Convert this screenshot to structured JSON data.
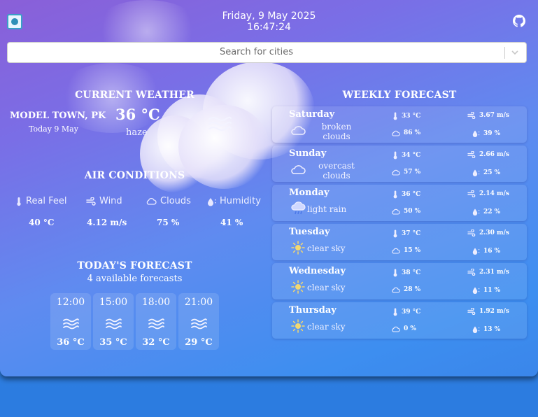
{
  "header": {
    "date": "Friday, 9 May 2025",
    "time": "16:47:24"
  },
  "search": {
    "placeholder": "Search for cities"
  },
  "current": {
    "title": "CURRENT WEATHER",
    "city": "MODEL TOWN, PK",
    "date": "Today 9 May",
    "temp": "36 °C",
    "description": "haze",
    "icon": "haze-icon"
  },
  "air": {
    "title": "AIR CONDITIONS",
    "items": [
      {
        "label": "Real Feel",
        "value": "40 °C",
        "icon": "thermometer-icon"
      },
      {
        "label": "Wind",
        "value": "4.12 m/s",
        "icon": "wind-icon"
      },
      {
        "label": "Clouds",
        "value": "75 %",
        "icon": "cloud-icon"
      },
      {
        "label": "Humidity",
        "value": "41 %",
        "icon": "humidity-icon"
      }
    ]
  },
  "today_forecast": {
    "title": "TODAY'S FORECAST",
    "subtitle": "4 available forecasts",
    "items": [
      {
        "time": "12:00",
        "temp": "36 °C",
        "icon": "haze-icon"
      },
      {
        "time": "15:00",
        "temp": "35 °C",
        "icon": "haze-icon"
      },
      {
        "time": "18:00",
        "temp": "32 °C",
        "icon": "haze-icon"
      },
      {
        "time": "21:00",
        "temp": "29 °C",
        "icon": "haze-icon"
      }
    ]
  },
  "weekly": {
    "title": "WEEKLY FORECAST",
    "days": [
      {
        "day": "Saturday",
        "cond1": "broken",
        "cond2": "clouds",
        "icon": "cloud-icon",
        "temp": "33 °C",
        "wind": "3.67 m/s",
        "clouds": "86 %",
        "humidity": "39 %"
      },
      {
        "day": "Sunday",
        "cond1": "overcast",
        "cond2": "clouds",
        "icon": "cloud-icon",
        "temp": "34 °C",
        "wind": "2.66 m/s",
        "clouds": "57 %",
        "humidity": "25 %"
      },
      {
        "day": "Monday",
        "cond1": "light rain",
        "cond2": "",
        "icon": "rain-icon",
        "temp": "36 °C",
        "wind": "2.14 m/s",
        "clouds": "50 %",
        "humidity": "22 %"
      },
      {
        "day": "Tuesday",
        "cond1": "clear sky",
        "cond2": "",
        "icon": "sun-icon",
        "temp": "37 °C",
        "wind": "2.30 m/s",
        "clouds": "15 %",
        "humidity": "16 %"
      },
      {
        "day": "Wednesday",
        "cond1": "clear sky",
        "cond2": "",
        "icon": "sun-icon",
        "temp": "38 °C",
        "wind": "2.31 m/s",
        "clouds": "28 %",
        "humidity": "11 %"
      },
      {
        "day": "Thursday",
        "cond1": "clear sky",
        "cond2": "",
        "icon": "sun-icon",
        "temp": "39 °C",
        "wind": "1.92 m/s",
        "clouds": "0 %",
        "humidity": "13 %"
      }
    ]
  }
}
